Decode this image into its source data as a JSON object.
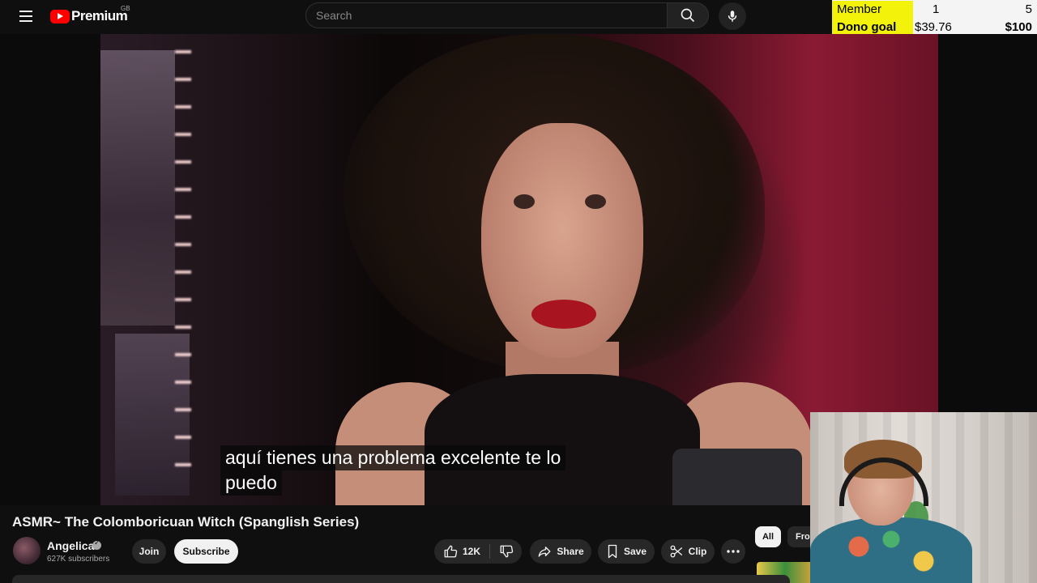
{
  "header": {
    "logo_text": "Premium",
    "region": "GB",
    "search_placeholder": "Search"
  },
  "goal_overlay": {
    "member_goal_label": "Member Goal",
    "member_goal_current": "1",
    "member_goal_target": "5",
    "dono_goal_label": "Dono goal",
    "dono_goal_current": "$39.76",
    "dono_goal_target": "$100"
  },
  "video": {
    "caption_line1": "aquí tienes una problema excelente te lo",
    "caption_line2": "puedo"
  },
  "meta": {
    "title": "ASMR~ The Colomboricuan Witch (Spanglish Series)",
    "channel_name": "Angelica",
    "subscribers": "627K subscribers",
    "join_label": "Join",
    "subscribe_label": "Subscribe",
    "like_count": "12K",
    "share_label": "Share",
    "save_label": "Save",
    "clip_label": "Clip"
  },
  "chips": {
    "all": "All",
    "from": "From"
  },
  "colors": {
    "background": "#0f0f0f",
    "brand_red": "#ff0000",
    "goal_highlight": "#f2f20a"
  }
}
